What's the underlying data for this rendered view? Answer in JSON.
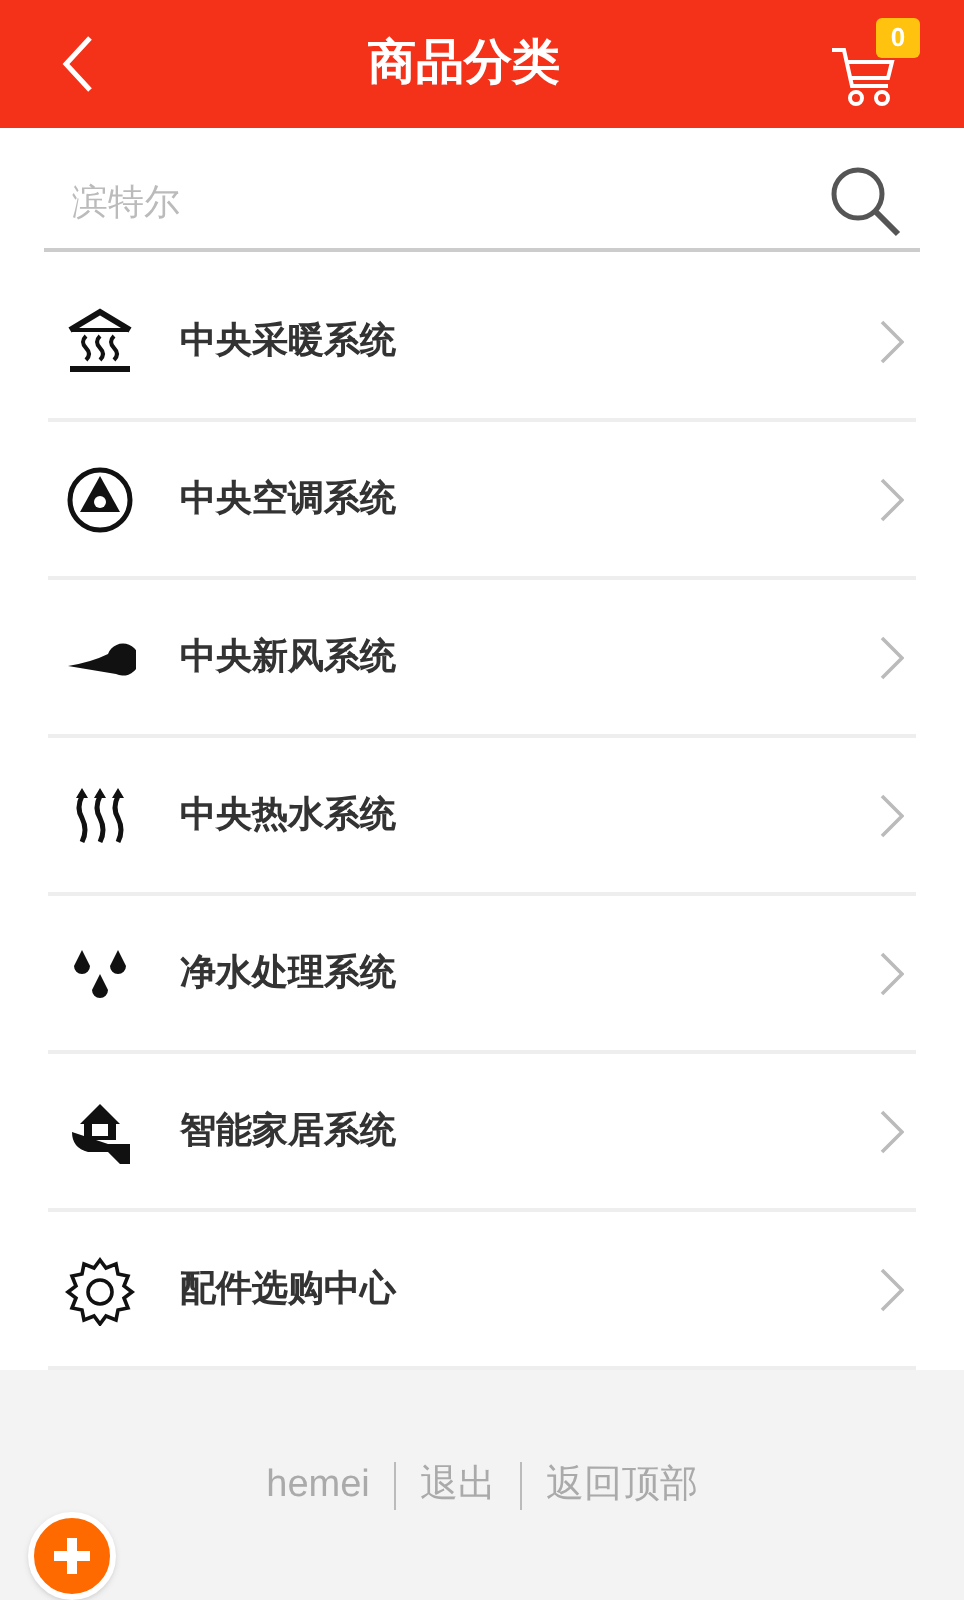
{
  "header": {
    "title": "商品分类",
    "cart_count": "0"
  },
  "search": {
    "placeholder": "滨特尔"
  },
  "categories": [
    {
      "label": "中央采暖系统",
      "kind": "heating"
    },
    {
      "label": "中央空调系统",
      "kind": "fan"
    },
    {
      "label": "中央新风系统",
      "kind": "wind"
    },
    {
      "label": "中央热水系统",
      "kind": "steam"
    },
    {
      "label": "净水处理系统",
      "kind": "drops"
    },
    {
      "label": "智能家居系统",
      "kind": "home"
    },
    {
      "label": "配件选购中心",
      "kind": "gear"
    }
  ],
  "footer": {
    "links": [
      "hemei",
      "退出",
      "返回顶部"
    ]
  }
}
